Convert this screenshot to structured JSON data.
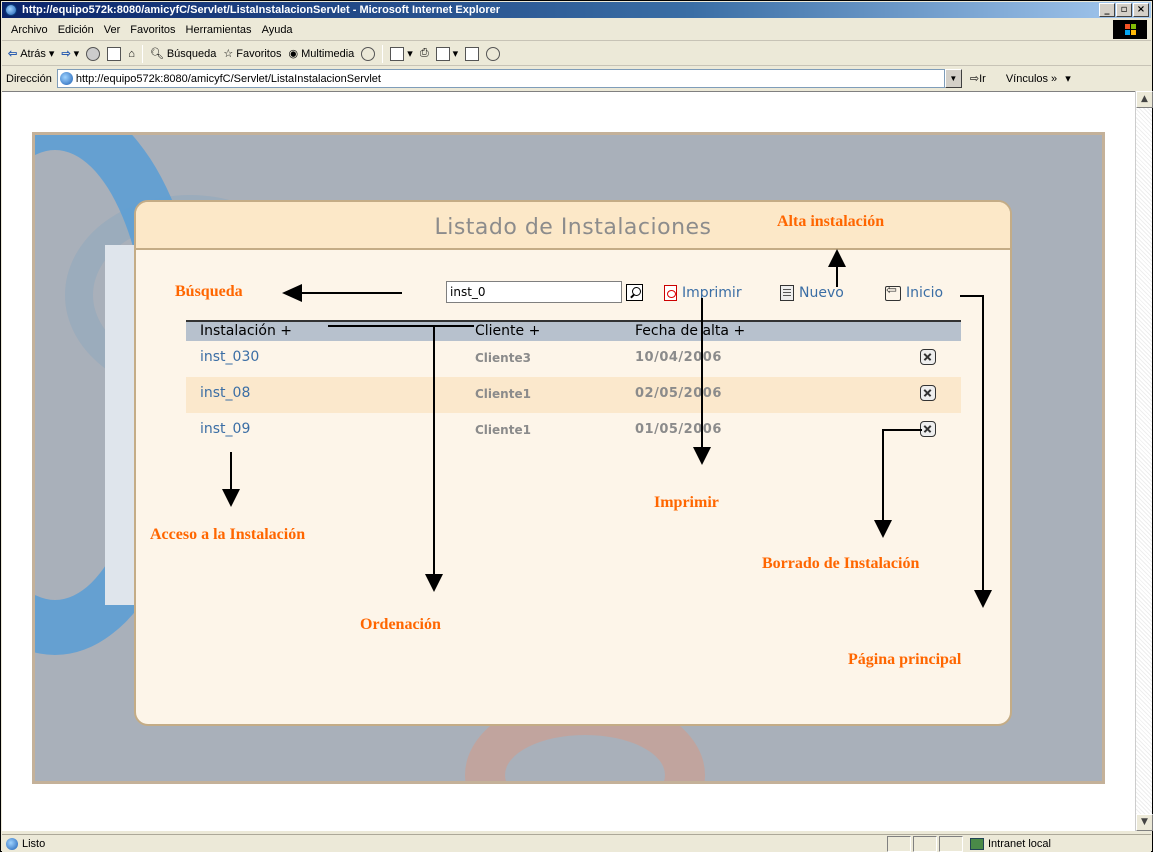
{
  "window": {
    "title": "http://equipo572k:8080/amicyfC/Servlet/ListaInstalacionServlet - Microsoft Internet Explorer",
    "min": "_",
    "max": "▫",
    "close": "×"
  },
  "menu": [
    "Archivo",
    "Edición",
    "Ver",
    "Favoritos",
    "Herramientas",
    "Ayuda"
  ],
  "toolbar": {
    "back": "Atrás",
    "search": "Búsqueda",
    "favorites": "Favoritos",
    "multimedia": "Multimedia"
  },
  "address": {
    "label": "Dirección",
    "url": "http://equipo572k:8080/amicyfC/Servlet/ListaInstalacionServlet",
    "go": "Ir",
    "links": "Vínculos »"
  },
  "status": {
    "text": "Listo",
    "zone": "Intranet local"
  },
  "page": {
    "title": "Listado de Instalaciones",
    "search_value": "inst_0",
    "actions": {
      "print": "Imprimir",
      "new": "Nuevo",
      "home": "Inicio"
    },
    "table": {
      "headers": [
        "Instalación +",
        "Cliente +",
        "Fecha de alta +"
      ],
      "rows": [
        {
          "inst": "inst_030",
          "client": "Cliente3",
          "date": "10/04/2006"
        },
        {
          "inst": "inst_08",
          "client": "Cliente1",
          "date": "02/05/2006"
        },
        {
          "inst": "inst_09",
          "client": "Cliente1",
          "date": "01/05/2006"
        }
      ]
    }
  },
  "annotations": {
    "busqueda": "Búsqueda",
    "alta": "Alta instalación",
    "acceso": "Acceso a la Instalación",
    "ordenacion": "Ordenación",
    "imprimir": "Imprimir",
    "borrado": "Borrado de Instalación",
    "principal": "Página principal"
  },
  "colors": {
    "accent_annotation": "#ff6600",
    "link": "#3b6ea5",
    "panel_bg": "#fdf5e9",
    "header_row": "#b7c1cd"
  }
}
